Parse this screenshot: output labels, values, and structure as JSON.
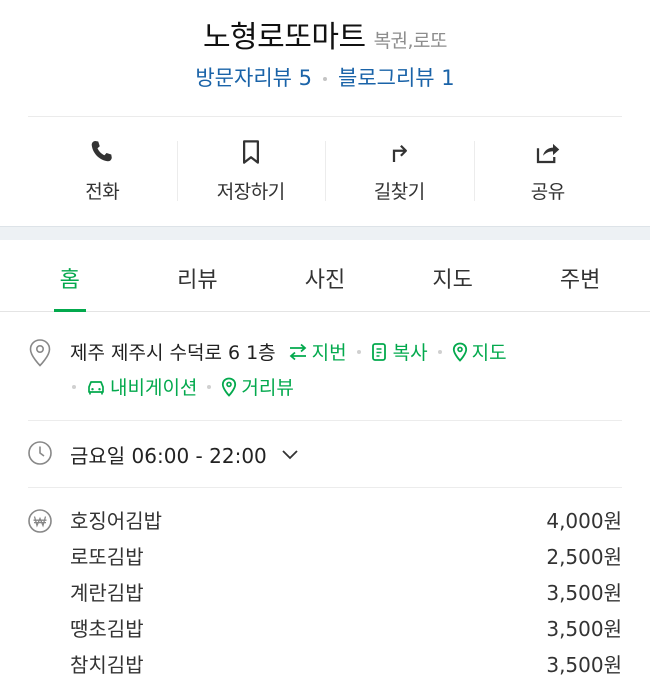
{
  "place": {
    "name": "노형로또마트",
    "category": "복권,로또",
    "visitor_reviews": "방문자리뷰 5",
    "blog_reviews": "블로그리뷰 1"
  },
  "actions": [
    {
      "label": "전화",
      "icon": "phone-icon"
    },
    {
      "label": "저장하기",
      "icon": "bookmark-icon"
    },
    {
      "label": "길찾기",
      "icon": "directions-icon"
    },
    {
      "label": "공유",
      "icon": "share-icon"
    }
  ],
  "tabs": [
    {
      "label": "홈",
      "active": true
    },
    {
      "label": "리뷰",
      "active": false
    },
    {
      "label": "사진",
      "active": false
    },
    {
      "label": "지도",
      "active": false
    },
    {
      "label": "주변",
      "active": false
    }
  ],
  "info": {
    "address": "제주 제주시 수덕로 6 1층",
    "lot_number": "지번",
    "copy": "복사",
    "map": "지도",
    "navigation": "내비게이션",
    "street_view": "거리뷰",
    "hours": "금요일 06:00 - 22:00"
  },
  "menu": [
    {
      "name": "호징어김밥",
      "price": "4,000원"
    },
    {
      "name": "로또김밥",
      "price": "2,500원"
    },
    {
      "name": "계란김밥",
      "price": "3,500원"
    },
    {
      "name": "땡초김밥",
      "price": "3,500원"
    },
    {
      "name": "참치김밥",
      "price": "3,500원"
    }
  ],
  "colors": {
    "accent_green": "#03a94d",
    "link_blue": "#1a63a8",
    "muted_gray": "#8e8e8e"
  }
}
